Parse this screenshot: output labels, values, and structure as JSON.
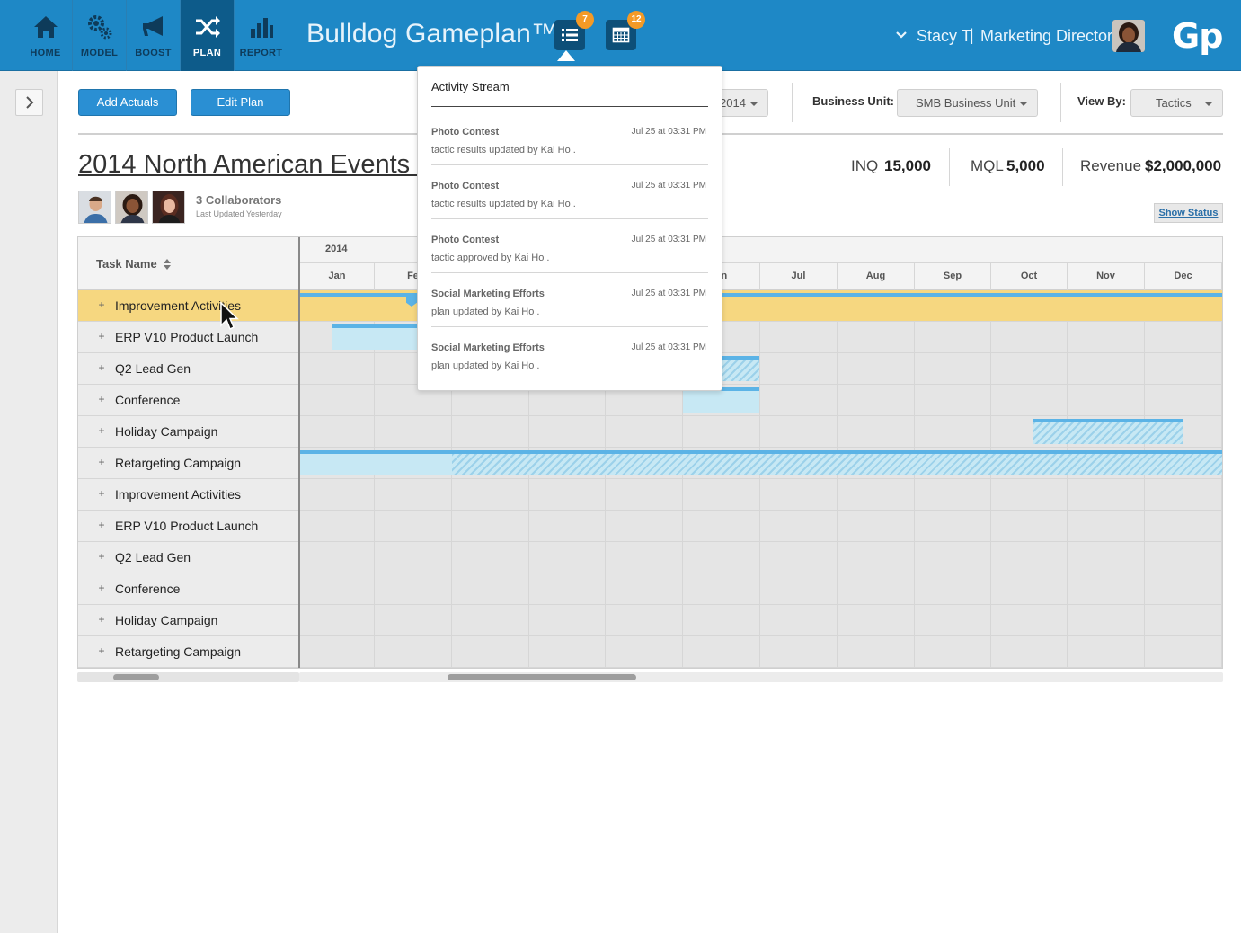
{
  "nav": {
    "items": [
      {
        "label": "HOME",
        "icon": "home-icon"
      },
      {
        "label": "MODEL",
        "icon": "gears-icon"
      },
      {
        "label": "BOOST",
        "icon": "megaphone-icon"
      },
      {
        "label": "PLAN",
        "icon": "shuffle-icon",
        "active": true
      },
      {
        "label": "REPORT",
        "icon": "bar-chart-icon"
      }
    ]
  },
  "app": {
    "title": "Bulldog Gameplan™",
    "logo": "Gp"
  },
  "header": {
    "activity_badge": "7",
    "calendar_badge": "12"
  },
  "user": {
    "name": "Stacy T",
    "separator": "|",
    "role": "Marketing Director"
  },
  "toolbar": {
    "add_actuals": "Add Actuals",
    "edit_plan": "Edit Plan",
    "year_value": "2014",
    "business_unit_label": "Business Unit:",
    "business_unit_value": "SMB Business Unit",
    "view_by_label": "View By:",
    "view_by_value": "Tactics"
  },
  "plan": {
    "title": "2014 North American Events w",
    "collaborators": "3 Collaborators",
    "last_updated": "Last Updated Yesterday",
    "show_status": "Show Status"
  },
  "metrics": [
    {
      "label": "INQ",
      "value": "15,000"
    },
    {
      "label": "MQL",
      "value": "5,000"
    },
    {
      "label": "Revenue",
      "value": "$2,000,000"
    }
  ],
  "gantt": {
    "task_header": "Task Name",
    "year": "2014",
    "months": [
      "Jan",
      "Fe",
      "",
      "",
      "",
      "un",
      "Jul",
      "Aug",
      "Sep",
      "Oct",
      "Nov",
      "Dec"
    ],
    "tasks": [
      "Improvement Activities",
      "ERP V10 Product Launch",
      "Q2 Lead Gen",
      "Conference",
      "Holiday Campaign",
      "Retargeting Campaign",
      "Improvement Activities",
      "ERP V10 Product Launch",
      "Q2 Lead Gen",
      "Conference",
      "Holiday Campaign",
      "Retargeting Campaign"
    ]
  },
  "activity_stream": {
    "title": "Activity Stream",
    "items": [
      {
        "title": "Photo Contest",
        "time": "Jul 25 at 03:31 PM",
        "desc": "tactic results  updated  by Kai Ho ."
      },
      {
        "title": "Photo Contest",
        "time": "Jul 25 at 03:31 PM",
        "desc": "tactic results  updated  by Kai Ho ."
      },
      {
        "title": "Photo Contest",
        "time": "Jul 25 at 03:31 PM",
        "desc": "tactic  approved  by Kai Ho ."
      },
      {
        "title": "Social Marketing Efforts",
        "time": "Jul 25 at 03:31 PM",
        "desc": "plan  updated  by Kai Ho ."
      },
      {
        "title": "Social Marketing Efforts",
        "time": "Jul 25 at 03:31 PM",
        "desc": "plan  updated  by Kai Ho ."
      }
    ]
  },
  "colors": {
    "brand": "#1e88c6",
    "nav_active": "#0d5b8a",
    "badge": "#f39a26",
    "row_highlight": "#f6d780",
    "bar": "#5bb3e6",
    "bar_fill": "#c7e8f4"
  }
}
